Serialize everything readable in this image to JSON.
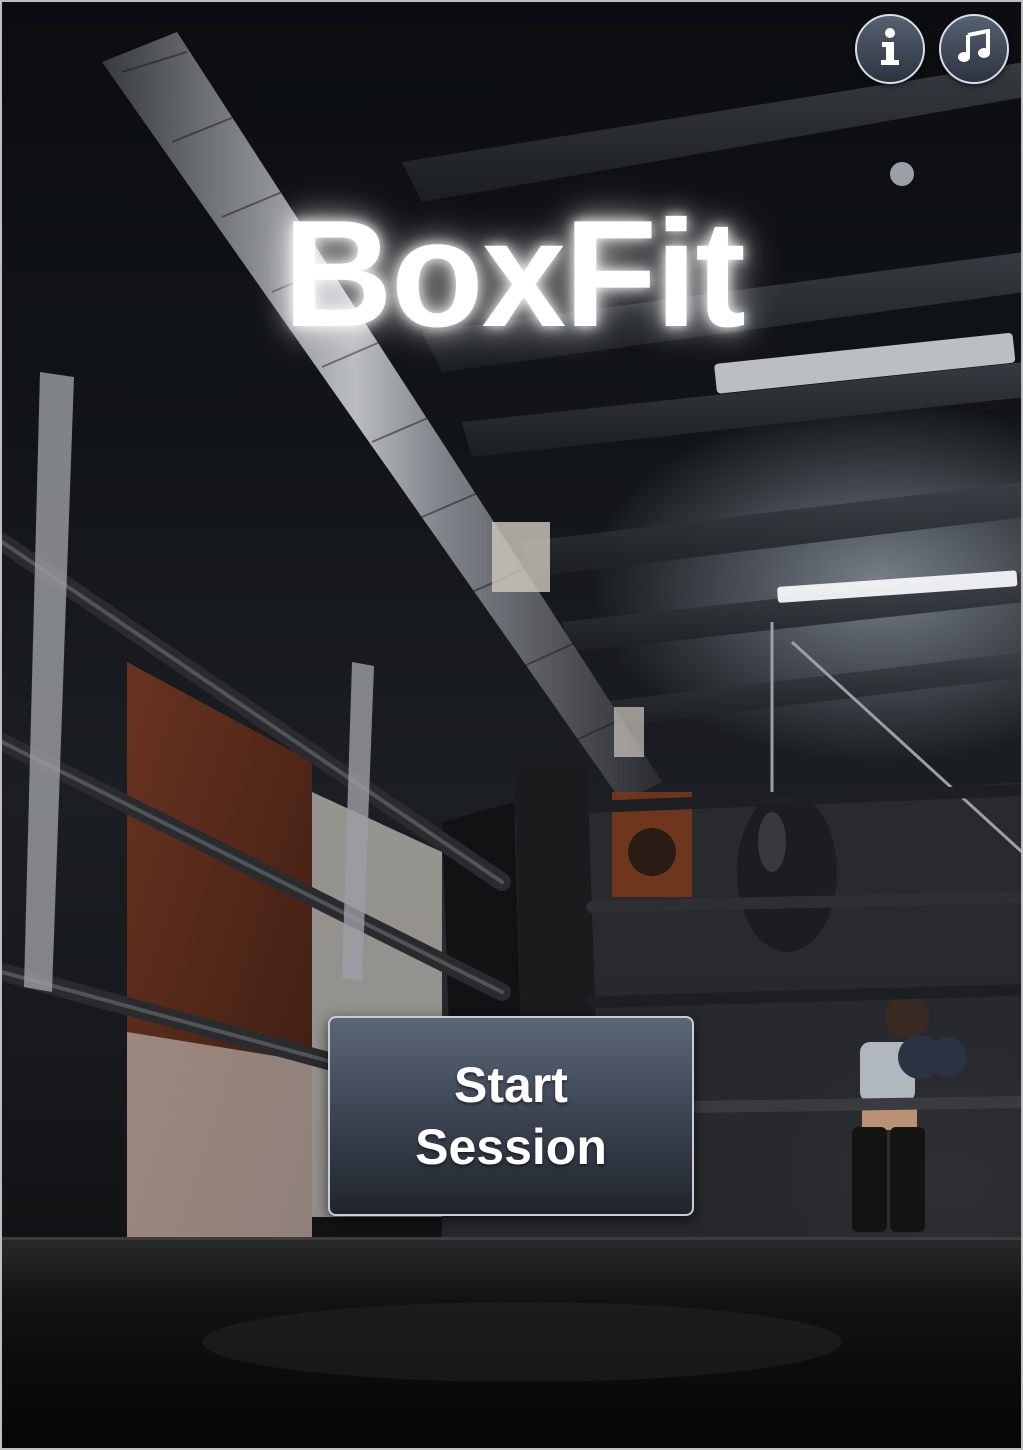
{
  "app": {
    "title": "BoxFit"
  },
  "header": {
    "info_icon": "info-icon",
    "music_icon": "music-note-icon"
  },
  "main": {
    "start_button_label": "Start Session"
  },
  "background": {
    "scene": "boxing-gym-photo"
  }
}
